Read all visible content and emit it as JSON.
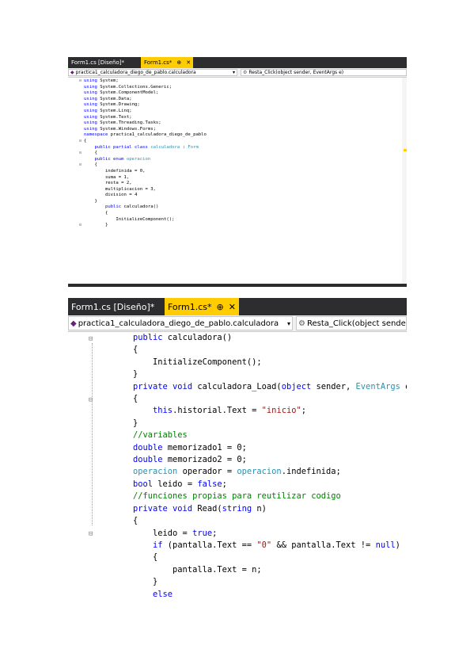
{
  "top_shot": {
    "tabs": [
      {
        "label": "Form1.cs [Diseño]*",
        "pin": "",
        "close": ""
      },
      {
        "label": "Form1.cs*",
        "pin": "⊕",
        "close": "✕"
      }
    ],
    "class_combo": "practica1_calculadora_diego_de_pablo.calculadora",
    "method_combo": "Resta_Click(object sender, EventArgs e)",
    "code_lines": [
      [
        {
          "c": "kw",
          "t": "using"
        },
        {
          "c": "plain",
          "t": " System;"
        }
      ],
      [
        {
          "c": "kw",
          "t": "using"
        },
        {
          "c": "plain",
          "t": " System.Collections.Generic;"
        }
      ],
      [
        {
          "c": "kw",
          "t": "using"
        },
        {
          "c": "plain",
          "t": " System.ComponentModel;"
        }
      ],
      [
        {
          "c": "kw",
          "t": "using"
        },
        {
          "c": "plain",
          "t": " System.Data;"
        }
      ],
      [
        {
          "c": "kw",
          "t": "using"
        },
        {
          "c": "plain",
          "t": " System.Drawing;"
        }
      ],
      [
        {
          "c": "kw",
          "t": "using"
        },
        {
          "c": "plain",
          "t": " System.Linq;"
        }
      ],
      [
        {
          "c": "kw",
          "t": "using"
        },
        {
          "c": "plain",
          "t": " System.Text;"
        }
      ],
      [
        {
          "c": "kw",
          "t": "using"
        },
        {
          "c": "plain",
          "t": " System.Threading.Tasks;"
        }
      ],
      [
        {
          "c": "kw",
          "t": "using"
        },
        {
          "c": "plain",
          "t": " System.Windows.Forms;"
        }
      ],
      [
        {
          "c": "plain",
          "t": ""
        }
      ],
      [
        {
          "c": "kw",
          "t": "namespace"
        },
        {
          "c": "plain",
          "t": " practica1_calculadora_diego_de_pablo"
        }
      ],
      [
        {
          "c": "plain",
          "t": "{"
        }
      ],
      [
        {
          "c": "plain",
          "t": "    "
        },
        {
          "c": "kw",
          "t": "public partial class"
        },
        {
          "c": "plain",
          "t": " "
        },
        {
          "c": "ty",
          "t": "calculadora"
        },
        {
          "c": "plain",
          "t": " : "
        },
        {
          "c": "ty",
          "t": "Form"
        }
      ],
      [
        {
          "c": "plain",
          "t": "    {"
        }
      ],
      [
        {
          "c": "plain",
          "t": "    "
        },
        {
          "c": "kw",
          "t": "public enum"
        },
        {
          "c": "plain",
          "t": " "
        },
        {
          "c": "ty",
          "t": "operacion"
        }
      ],
      [
        {
          "c": "plain",
          "t": "    {"
        }
      ],
      [
        {
          "c": "plain",
          "t": "        indefinida = 0,"
        }
      ],
      [
        {
          "c": "plain",
          "t": "        suma = 1,"
        }
      ],
      [
        {
          "c": "plain",
          "t": "        resta = 2,"
        }
      ],
      [
        {
          "c": "plain",
          "t": "        multiplicacion = 3,"
        }
      ],
      [
        {
          "c": "plain",
          "t": "        division = 4"
        }
      ],
      [
        {
          "c": "plain",
          "t": "    }"
        }
      ],
      [
        {
          "c": "plain",
          "t": ""
        }
      ],
      [
        {
          "c": "plain",
          "t": ""
        }
      ],
      [
        {
          "c": "plain",
          "t": "        "
        },
        {
          "c": "kw",
          "t": "public"
        },
        {
          "c": "plain",
          "t": " calculadora()"
        }
      ],
      [
        {
          "c": "plain",
          "t": "        {"
        }
      ],
      [
        {
          "c": "plain",
          "t": "            InitializeComponent();"
        }
      ],
      [
        {
          "c": "plain",
          "t": "        }"
        }
      ]
    ]
  },
  "bottom_shot": {
    "tabs": [
      {
        "label": "Form1.cs [Diseño]*",
        "pin": "",
        "close": ""
      },
      {
        "label": "Form1.cs*",
        "pin": "⊕",
        "close": "✕"
      }
    ],
    "class_combo": "practica1_calculadora_diego_de_pablo.calculadora",
    "method_combo": "Resta_Click(object sender, Ev",
    "code_lines": [
      [
        {
          "c": "kw",
          "t": "public"
        },
        {
          "c": "plain",
          "t": " calculadora()"
        }
      ],
      [
        {
          "c": "plain",
          "t": "{"
        }
      ],
      [
        {
          "c": "plain",
          "t": "    InitializeComponent();"
        }
      ],
      [
        {
          "c": "plain",
          "t": "}"
        }
      ],
      [
        {
          "c": "plain",
          "t": ""
        }
      ],
      [
        {
          "c": "kw",
          "t": "private void"
        },
        {
          "c": "plain",
          "t": " calculadora_Load("
        },
        {
          "c": "kw",
          "t": "object"
        },
        {
          "c": "plain",
          "t": " sender, "
        },
        {
          "c": "ty",
          "t": "EventArgs"
        },
        {
          "c": "plain",
          "t": " e)"
        }
      ],
      [
        {
          "c": "plain",
          "t": "{"
        }
      ],
      [
        {
          "c": "plain",
          "t": "    "
        },
        {
          "c": "kw",
          "t": "this"
        },
        {
          "c": "plain",
          "t": ".historial.Text = "
        },
        {
          "c": "str",
          "t": "\"inicio\""
        },
        {
          "c": "plain",
          "t": ";"
        }
      ],
      [
        {
          "c": "plain",
          "t": "}"
        }
      ],
      [
        {
          "c": "plain",
          "t": ""
        }
      ],
      [
        {
          "c": "com",
          "t": "//variables"
        }
      ],
      [
        {
          "c": "kw",
          "t": "double"
        },
        {
          "c": "plain",
          "t": " memorizado1 = 0;"
        }
      ],
      [
        {
          "c": "kw",
          "t": "double"
        },
        {
          "c": "plain",
          "t": " memorizado2 = 0;"
        }
      ],
      [
        {
          "c": "ty",
          "t": "operacion"
        },
        {
          "c": "plain",
          "t": " operador = "
        },
        {
          "c": "ty",
          "t": "operacion"
        },
        {
          "c": "plain",
          "t": ".indefinida;"
        }
      ],
      [
        {
          "c": "kw",
          "t": "bool"
        },
        {
          "c": "plain",
          "t": " leido = "
        },
        {
          "c": "kw",
          "t": "false"
        },
        {
          "c": "plain",
          "t": ";"
        }
      ],
      [
        {
          "c": "com",
          "t": "//funciones propias para reutilizar codigo"
        }
      ],
      [
        {
          "c": "kw",
          "t": "private void"
        },
        {
          "c": "plain",
          "t": " Read("
        },
        {
          "c": "kw",
          "t": "string"
        },
        {
          "c": "plain",
          "t": " n)"
        }
      ],
      [
        {
          "c": "plain",
          "t": "{"
        }
      ],
      [
        {
          "c": "plain",
          "t": "    leido = "
        },
        {
          "c": "kw",
          "t": "true"
        },
        {
          "c": "plain",
          "t": ";"
        }
      ],
      [
        {
          "c": "plain",
          "t": "    "
        },
        {
          "c": "kw",
          "t": "if"
        },
        {
          "c": "plain",
          "t": " (pantalla.Text == "
        },
        {
          "c": "str",
          "t": "\"0\""
        },
        {
          "c": "plain",
          "t": " && pantalla.Text != "
        },
        {
          "c": "kw",
          "t": "null"
        },
        {
          "c": "plain",
          "t": ")"
        }
      ],
      [
        {
          "c": "plain",
          "t": "    {"
        }
      ],
      [
        {
          "c": "plain",
          "t": "        pantalla.Text = n;"
        }
      ],
      [
        {
          "c": "plain",
          "t": "    }"
        }
      ],
      [
        {
          "c": "plain",
          "t": "    "
        },
        {
          "c": "kw",
          "t": "else"
        }
      ],
      [
        {
          "c": "plain",
          "t": "    {"
        }
      ]
    ]
  }
}
